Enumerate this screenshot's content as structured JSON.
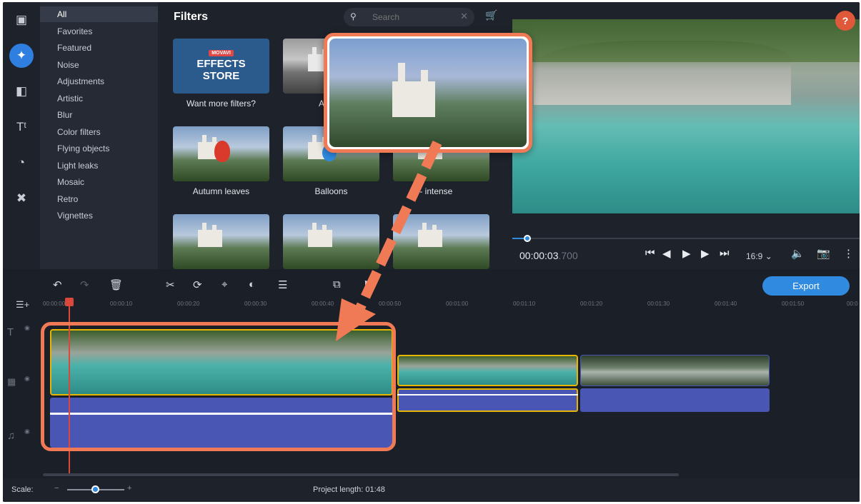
{
  "sidebar": {
    "icons": [
      "import-icon",
      "magic-wand-icon",
      "transitions-icon",
      "titles-icon",
      "stickers-icon",
      "tools-icon"
    ],
    "active": 1
  },
  "categories": [
    "All",
    "Favorites",
    "Featured",
    "Noise",
    "Adjustments",
    "Artistic",
    "Blur",
    "Color filters",
    "Flying objects",
    "Light leaks",
    "Mosaic",
    "Retro",
    "Vignettes"
  ],
  "filters": {
    "title": "Filters",
    "search_placeholder": "Search",
    "store_badge": "MOVAVI",
    "store_line1": "EFFECTS",
    "store_line2": "STORE",
    "tiles": [
      {
        "label": "Want more filters?"
      },
      {
        "label": "A"
      },
      {
        "label": "Autumn leaves"
      },
      {
        "label": "Balloons"
      },
      {
        "label": "r - intense"
      }
    ]
  },
  "preview": {
    "help": "?",
    "time_main": "00:00:03",
    "time_ms": ".700",
    "ratio": "16:9",
    "progress": 0.04
  },
  "timeline": {
    "export": "Export",
    "ticks": [
      "00:00:00",
      "00:00:10",
      "00:00:20",
      "00:00:30",
      "00:00:40",
      "00:00:50",
      "00:01:00",
      "00:01:10",
      "00:01:20",
      "00:01:30",
      "00:01:40",
      "00:01:50",
      "00:0"
    ]
  },
  "status": {
    "scale_label": "Scale:",
    "project_length_label": "Project length:",
    "project_length": "01:48"
  },
  "colors": {
    "accent": "#2f8ae0",
    "annotation": "#f07a55",
    "audio_track": "#4a56b4",
    "clip_border": "#e8b600"
  }
}
